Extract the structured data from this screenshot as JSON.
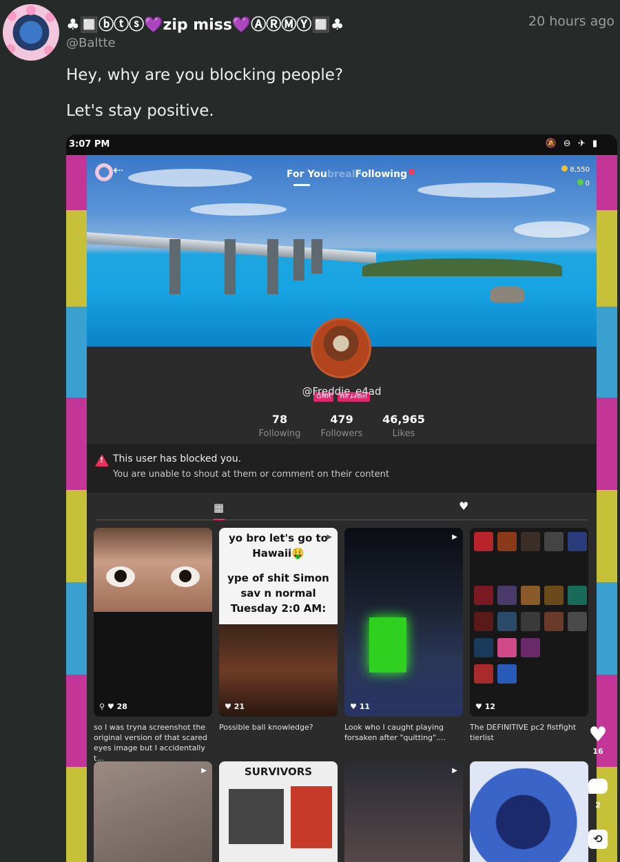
{
  "post": {
    "username": "♣🔲ⓑⓣⓢ💜zip miss💜ⒶⓇⓂⓎ🔲♣",
    "handle": "@Baltte",
    "timestamp": "20 hours ago",
    "lines": [
      "Hey, why are you blocking people?",
      "Let's stay positive."
    ]
  },
  "screenshot": {
    "status_time": "3:07 PM",
    "tabs": {
      "for_you": "For You",
      "overlap": "breal",
      "following": "Following"
    },
    "coins": "8,550",
    "gems": "0",
    "profile_tags": [
      "GMR",
      "He / Him"
    ],
    "profile_handle": "@Freddie_e4ad",
    "stats": [
      {
        "value": "78",
        "label": "Following"
      },
      {
        "value": "479",
        "label": "Followers"
      },
      {
        "value": "46,965",
        "label": "Likes"
      }
    ],
    "blocked": {
      "title": "This user has blocked you.",
      "subtitle": "You are unable to shout at them or comment on their content"
    },
    "cards": [
      {
        "likes": "28",
        "pinned": true,
        "caption": "so I was tryna screenshot the original version of that scared eyes image but I accidentally t..."
      },
      {
        "likes": "21",
        "caption": "Possible ball knowledge?",
        "text_top": "yo bro let's go to Hawaii🤑",
        "text_mid": "ype of shit Simon sav n normal Tuesday 2:0 AM:"
      },
      {
        "likes": "11",
        "caption": "Look who I caught playing forsaken after \"quitting\"...."
      },
      {
        "likes": "12",
        "caption": "The DEFINITIVE pc2 fistfight tierlist"
      }
    ],
    "row2_title": "SURVIVORS"
  },
  "actions": {
    "like_count": "16",
    "comment_count": "2"
  },
  "colors": {
    "background": "#262a28",
    "stripe_magenta": "#c33596",
    "stripe_yellow": "#c7c13a",
    "stripe_cyan": "#3aa0cf",
    "alert_red": "#e9325f"
  },
  "icons": [
    "heart-icon",
    "comment-icon",
    "repost-icon",
    "warning-icon",
    "grid-icon",
    "back-icon",
    "coin-icon",
    "gem-icon",
    "play-icon"
  ]
}
